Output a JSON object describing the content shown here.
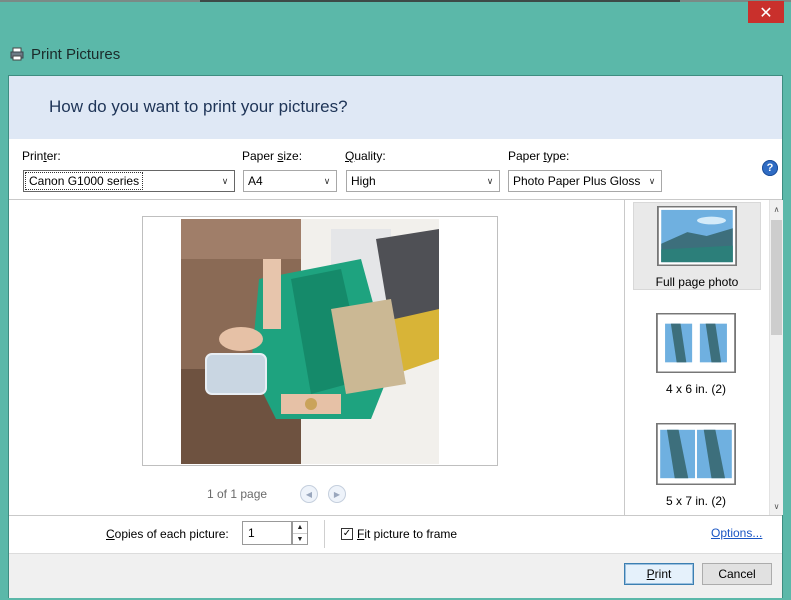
{
  "window": {
    "title": "Print Pictures",
    "close_symbol": "✕"
  },
  "header": {
    "question": "How do you want to print your pictures?"
  },
  "controls": {
    "printer": {
      "label": "Printer:",
      "value": "Canon G1000 series"
    },
    "paper_size": {
      "label": "Paper size:",
      "value": "A4"
    },
    "quality": {
      "label": "Quality:",
      "value": "High"
    },
    "paper_type": {
      "label": "Paper type:",
      "value": "Photo Paper Plus Gloss"
    },
    "help_symbol": "?"
  },
  "preview": {
    "page_count": "1 of 1 page",
    "prev_symbol": "◀",
    "next_symbol": "▶"
  },
  "layouts": [
    {
      "label": "Full page photo",
      "selected": true
    },
    {
      "label": "4 x 6 in. (2)",
      "selected": false
    },
    {
      "label": "5 x 7 in. (2)",
      "selected": false
    }
  ],
  "options": {
    "copies_label": "Copies of each picture:",
    "copies_value": "1",
    "fit_label": "Fit picture to frame",
    "fit_checked": true,
    "options_link": "Options..."
  },
  "footer": {
    "print_label": "Print",
    "cancel_label": "Cancel"
  },
  "colors": {
    "accent": "#5bb8a9",
    "close": "#c9302c",
    "link": "#1a56c4",
    "header_bg": "#dfe8f5"
  }
}
